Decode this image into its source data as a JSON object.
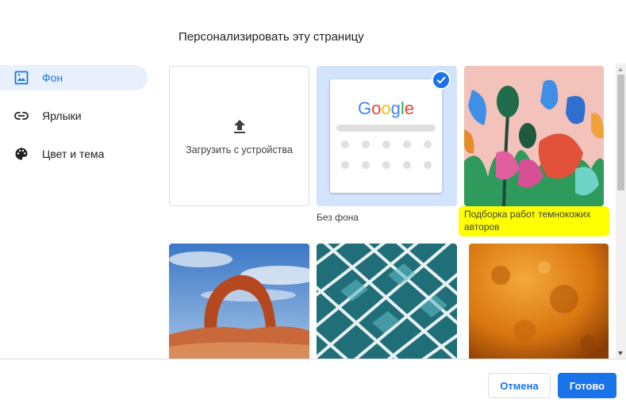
{
  "dialog": {
    "title": "Персонализировать эту страницу"
  },
  "sidebar": {
    "items": [
      {
        "label": "Фон",
        "icon": "background-image-icon",
        "active": true
      },
      {
        "label": "Ярлыки",
        "icon": "link-icon",
        "active": false
      },
      {
        "label": "Цвет и тема",
        "icon": "palette-icon",
        "active": false
      }
    ]
  },
  "backgrounds": {
    "upload_label": "Загрузить с устройства",
    "no_background_label": "Без фона",
    "google_logo": "Google",
    "collection_label": "Подборка работ темнокожих авторов"
  },
  "footer": {
    "cancel_label": "Отмена",
    "done_label": "Готово"
  },
  "colors": {
    "accent": "#1a73e8",
    "active_bg": "#e8f0fe",
    "highlight": "#ffff00",
    "selected_tile": "#d2e3fc"
  }
}
